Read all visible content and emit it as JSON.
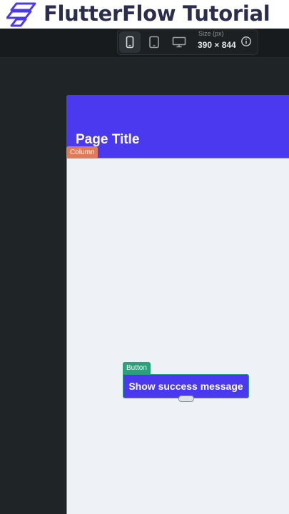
{
  "banner": {
    "title": "FlutterFlow Tutorial",
    "logo_icon": "flutterflow-logo-icon",
    "accent": "#4b39ef"
  },
  "toolbar": {
    "devices": [
      "phone-icon",
      "tablet-icon",
      "desktop-icon"
    ],
    "active_device": "phone",
    "size_label": "Size (px)",
    "size_value": "390 × 844",
    "info_icon": "info-icon"
  },
  "canvas": {
    "page_title": "Page Title",
    "column_tag": "Column",
    "button_tag": "Button",
    "button_label": "Show success message",
    "appbar_color": "#4b39ef",
    "column_tag_color": "#e07b5a",
    "button_tag_color": "#2ba07a"
  }
}
